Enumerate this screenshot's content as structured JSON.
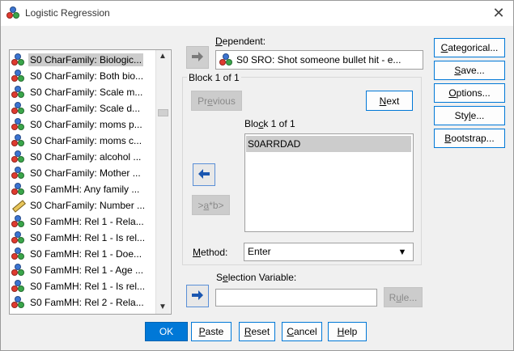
{
  "window": {
    "title": "Logistic Regression",
    "close_glyph": "✕"
  },
  "variable_list": {
    "items": [
      {
        "label": "S0 CharFamily: Biologic...",
        "icon": "nominal-icon",
        "selected": true
      },
      {
        "label": "S0 CharFamily: Both bio...",
        "icon": "nominal-icon"
      },
      {
        "label": "S0 CharFamily: Scale m...",
        "icon": "nominal-icon"
      },
      {
        "label": "S0 CharFamily: Scale d...",
        "icon": "nominal-icon"
      },
      {
        "label": "S0 CharFamily: moms p...",
        "icon": "nominal-icon"
      },
      {
        "label": "S0 CharFamily: moms c...",
        "icon": "nominal-icon"
      },
      {
        "label": "S0 CharFamily: alcohol ...",
        "icon": "nominal-icon"
      },
      {
        "label": "S0 CharFamily: Mother ...",
        "icon": "nominal-icon"
      },
      {
        "label": "S0 FamMH: Any family ...",
        "icon": "nominal-icon"
      },
      {
        "label": "S0 CharFamily: Number ...",
        "icon": "scale-ruler-icon"
      },
      {
        "label": "S0 FamMH: Rel 1 - Rela...",
        "icon": "nominal-icon"
      },
      {
        "label": "S0 FamMH: Rel 1 - Is rel...",
        "icon": "nominal-icon"
      },
      {
        "label": "S0 FamMH: Rel 1 - Doe...",
        "icon": "nominal-icon"
      },
      {
        "label": "S0 FamMH: Rel 1 - Age ...",
        "icon": "nominal-icon"
      },
      {
        "label": "S0 FamMH: Rel 1 - Is rel...",
        "icon": "nominal-icon"
      },
      {
        "label": "S0 FamMH: Rel 2 - Rela...",
        "icon": "nominal-icon"
      }
    ]
  },
  "dependent": {
    "label": "Dependent:",
    "value": "S0 SRO: Shot someone bullet hit - e..."
  },
  "block": {
    "title": "Block 1 of 1",
    "previous_label": "Previous",
    "next_label": "Next",
    "sub_title": "Block 1 of 1",
    "covariates": [
      "S0ARRDAD"
    ],
    "interaction_label": ">a*b>"
  },
  "method": {
    "label": "Method:",
    "value": "Enter"
  },
  "selection": {
    "label": "Selection Variable:",
    "value": "",
    "rule_label": "Rule..."
  },
  "side_buttons": {
    "categorical": "Categorical...",
    "save": "Save...",
    "options": "Options...",
    "style": "Style...",
    "bootstrap": "Bootstrap..."
  },
  "bottom_buttons": {
    "ok": "OK",
    "paste": "Paste",
    "reset": "Reset",
    "cancel": "Cancel",
    "help": "Help"
  },
  "colors": {
    "accent": "#0078d7",
    "selected_row": "#cccccc"
  }
}
